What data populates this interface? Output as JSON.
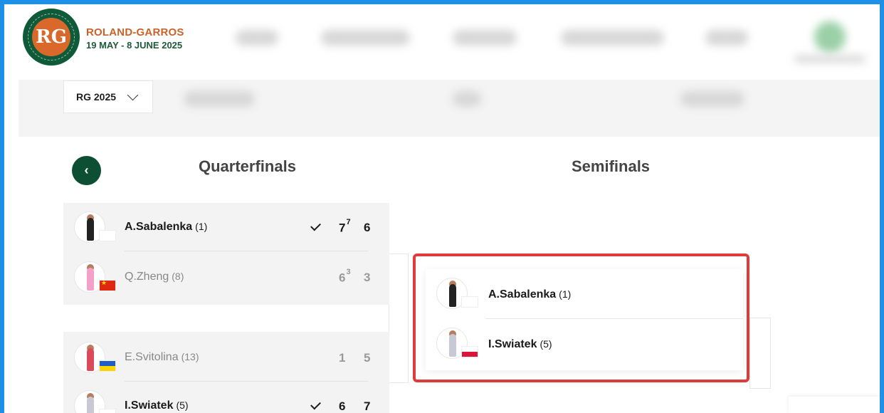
{
  "brand": {
    "title": "ROLAND-GARROS",
    "dates": "19 MAY - 8 JUNE 2025",
    "colors": {
      "green": "#0f5a38",
      "clay": "#d9682a",
      "highlight": "#e03b3b",
      "frame": "#1e90e8"
    }
  },
  "year_select": {
    "value": "RG 2025"
  },
  "rounds": {
    "left": "Quarterfinals",
    "right": "Semifinals"
  },
  "quarterfinals": [
    {
      "players": [
        {
          "name": "A.Sabalenka",
          "seed": "(1)",
          "winner": true,
          "flag": "blank",
          "sets": [
            {
              "g": "7",
              "tb": "7"
            },
            {
              "g": "6",
              "tb": ""
            }
          ]
        },
        {
          "name": "Q.Zheng",
          "seed": "(8)",
          "winner": false,
          "flag": "cn",
          "sets": [
            {
              "g": "6",
              "tb": "3"
            },
            {
              "g": "3",
              "tb": ""
            }
          ]
        }
      ]
    },
    {
      "players": [
        {
          "name": "E.Svitolina",
          "seed": "(13)",
          "winner": false,
          "flag": "ua",
          "sets": [
            {
              "g": "1",
              "tb": ""
            },
            {
              "g": "5",
              "tb": ""
            }
          ]
        },
        {
          "name": "I.Swiatek",
          "seed": "(5)",
          "winner": true,
          "flag": "pl",
          "sets": [
            {
              "g": "6",
              "tb": ""
            },
            {
              "g": "7",
              "tb": ""
            }
          ]
        }
      ]
    }
  ],
  "semifinal": {
    "players": [
      {
        "name": "A.Sabalenka",
        "seed": "(1)",
        "flag": "blank"
      },
      {
        "name": "I.Swiatek",
        "seed": "(5)",
        "flag": "pl"
      }
    ]
  },
  "icons": {
    "back": "chevron-left-icon",
    "dropdown": "chevron-down-icon",
    "winner": "check-icon"
  }
}
